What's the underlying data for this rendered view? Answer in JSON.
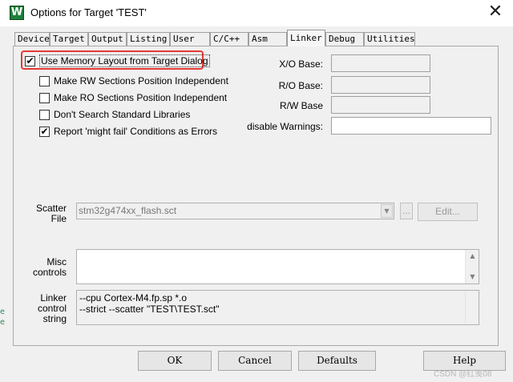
{
  "window": {
    "title": "Options for Target 'TEST'",
    "icon_letter": "W"
  },
  "tabs": [
    "Device",
    "Target",
    "Output",
    "Listing",
    "User",
    "C/C++",
    "Asm",
    "Linker",
    "Debug",
    "Utilities"
  ],
  "active_tab": "Linker",
  "options": [
    {
      "label": "Use Memory Layout from Target Dialog",
      "checked": true
    },
    {
      "label": "Make RW Sections Position Independent",
      "checked": false
    },
    {
      "label": "Make RO Sections Position Independent",
      "checked": false
    },
    {
      "label": "Don't Search Standard Libraries",
      "checked": false
    },
    {
      "label": "Report 'might fail' Conditions as Errors",
      "checked": true
    }
  ],
  "fields": {
    "xo_base": {
      "label": "X/O Base:",
      "value": ""
    },
    "ro_base": {
      "label": "R/O Base:",
      "value": ""
    },
    "rw_base": {
      "label": "R/W Base",
      "value": ""
    },
    "disable_warnings": {
      "label": "disable Warnings:",
      "value": ""
    }
  },
  "scatter": {
    "label_line1": "Scatter",
    "label_line2": "File",
    "value": "stm32g474xx_flash.sct",
    "browse_label": "...",
    "edit_label": "Edit..."
  },
  "misc": {
    "label_line1": "Misc",
    "label_line2": "controls",
    "value": ""
  },
  "linker": {
    "label_line1": "Linker",
    "label_line2": "control",
    "label_line3": "string",
    "line1": "--cpu Cortex-M4.fp.sp *.o",
    "line2": "--strict --scatter \"TEST\\TEST.sct\""
  },
  "buttons": {
    "ok": "OK",
    "cancel": "Cancel",
    "defaults": "Defaults",
    "help": "Help"
  },
  "watermark": "CSDN @红笺08",
  "edge_fragments": [
    "e",
    "e"
  ]
}
